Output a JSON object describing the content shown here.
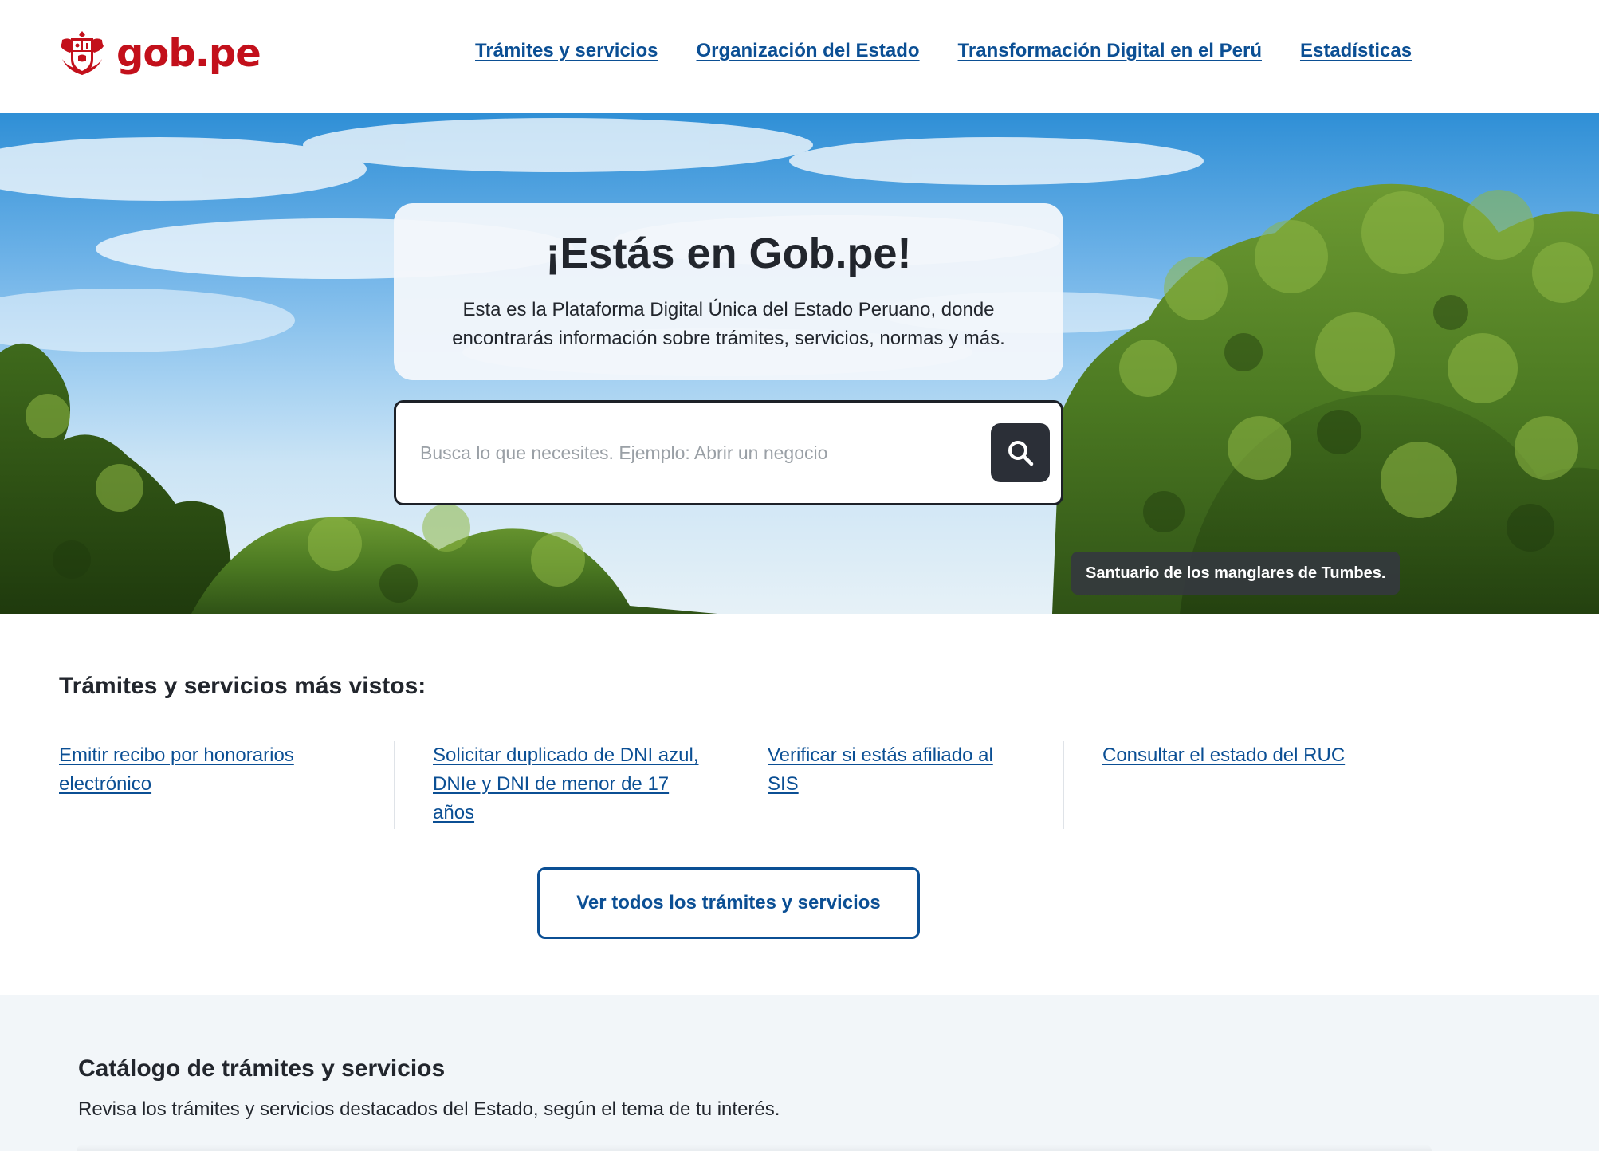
{
  "header": {
    "logo_text": "gob.pe",
    "nav": [
      "Trámites y servicios",
      "Organización del Estado",
      "Transformación Digital en el Perú",
      "Estadísticas"
    ]
  },
  "hero": {
    "title": "¡Estás en Gob.pe!",
    "description": "Esta es la Plataforma Digital Única del Estado Peruano, donde encontrarás información sobre trámites, servicios, normas y más.",
    "search_placeholder": "Busca lo que necesites. Ejemplo: Abrir un negocio",
    "search_value": "",
    "photo_caption": "Santuario de los manglares de Tumbes."
  },
  "most_viewed": {
    "title": "Trámites y servicios más vistos:",
    "items": [
      "Emitir recibo por honorarios electrónico",
      "Solicitar duplicado de DNI azul, DNIe y DNI de menor de 17 años",
      "Verificar si estás afiliado al SIS",
      "Consultar el estado del RUC"
    ],
    "see_all_label": "Ver todos los trámites y servicios"
  },
  "catalog": {
    "title": "Catálogo de trámites y servicios",
    "description": "Revisa los trámites y servicios destacados del Estado, según el tema de tu interés."
  },
  "colors": {
    "brand_red": "#c3101b",
    "link_blue": "#0b4f94",
    "text_dark": "#22262d",
    "search_button": "#2b2f37",
    "catalog_bg": "#f2f6f9"
  }
}
